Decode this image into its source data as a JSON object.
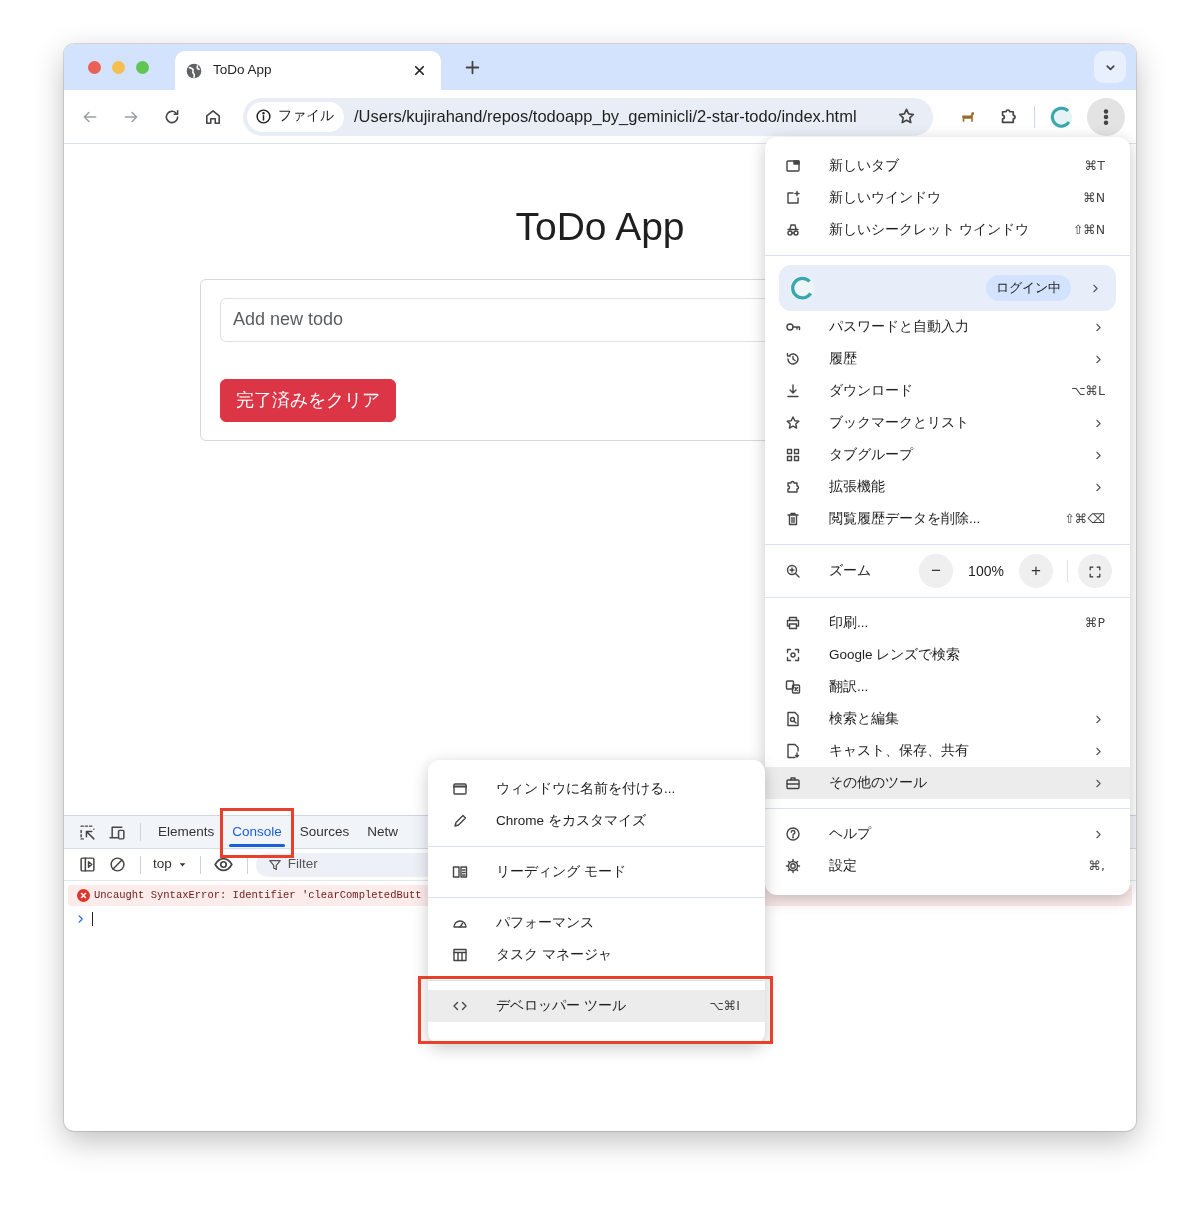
{
  "browser": {
    "tab": {
      "title": "ToDo App"
    },
    "address": {
      "chip": "ファイル",
      "url": "/Users/kujirahand/repos/todoapp_by_geminicli/2-star-todo/index.html"
    }
  },
  "page": {
    "title": "ToDo App",
    "input": {
      "placeholder": "Add new todo"
    },
    "clear_button": "完了済みをクリア"
  },
  "devtools": {
    "tabs": [
      {
        "label": "Elements",
        "selected": false,
        "annotated": false
      },
      {
        "label": "Console",
        "selected": true,
        "annotated": true
      },
      {
        "label": "Sources",
        "selected": false,
        "annotated": false
      },
      {
        "label": "Netw",
        "selected": false,
        "annotated": false
      }
    ],
    "context": "top",
    "filter": {
      "placeholder": "Filter"
    },
    "messages": [
      {
        "kind": "error",
        "text": "Uncaught SyntaxError: Identifier 'clearCompletedButt"
      }
    ]
  },
  "menu": {
    "sections": [
      {
        "items": [
          {
            "kind": "item",
            "label": "新しいタブ",
            "shortcut": "⌘T",
            "submenu": false,
            "selected": false
          },
          {
            "kind": "item",
            "label": "新しいウインドウ",
            "shortcut": "⌘N",
            "submenu": false,
            "selected": false
          },
          {
            "kind": "item",
            "label": "新しいシークレット ウインドウ",
            "shortcut": "⇧⌘N",
            "submenu": false,
            "selected": false
          }
        ]
      },
      {
        "items": [
          {
            "kind": "profile",
            "badge": "ログイン中",
            "submenu": true,
            "selected": false
          },
          {
            "kind": "item",
            "label": "パスワードと自動入力",
            "submenu": true,
            "selected": false
          },
          {
            "kind": "item",
            "label": "履歴",
            "submenu": true,
            "selected": false
          },
          {
            "kind": "item",
            "label": "ダウンロード",
            "shortcut": "⌥⌘L",
            "submenu": false,
            "selected": false
          },
          {
            "kind": "item",
            "label": "ブックマークとリスト",
            "submenu": true,
            "selected": false
          },
          {
            "kind": "item",
            "label": "タブグループ",
            "submenu": true,
            "selected": false
          },
          {
            "kind": "item",
            "label": "拡張機能",
            "submenu": true,
            "selected": false
          },
          {
            "kind": "item",
            "label": "閲覧履歴データを削除...",
            "shortcut": "⇧⌘⌫",
            "submenu": false,
            "selected": false
          }
        ]
      },
      {
        "items": [
          {
            "kind": "zoom",
            "label": "ズーム",
            "minus": "−",
            "value": "100%",
            "plus": "+"
          }
        ]
      },
      {
        "items": [
          {
            "kind": "item",
            "label": "印刷...",
            "shortcut": "⌘P",
            "submenu": false,
            "selected": false
          },
          {
            "kind": "item",
            "label": "Google レンズで検索",
            "submenu": false,
            "selected": false
          },
          {
            "kind": "item",
            "label": "翻訳...",
            "submenu": false,
            "selected": false
          },
          {
            "kind": "item",
            "label": "検索と編集",
            "submenu": true,
            "selected": false
          },
          {
            "kind": "item",
            "label": "キャスト、保存、共有",
            "submenu": true,
            "selected": false
          },
          {
            "kind": "item",
            "label": "その他のツール",
            "submenu": true,
            "selected": true
          }
        ]
      },
      {
        "items": [
          {
            "kind": "item",
            "label": "ヘルプ",
            "submenu": true,
            "selected": false
          },
          {
            "kind": "item",
            "label": "設定",
            "shortcut": "⌘,",
            "submenu": false,
            "selected": false
          }
        ]
      }
    ]
  },
  "submenu": {
    "sections": [
      {
        "items": [
          {
            "label": "ウィンドウに名前を付ける...",
            "selected": false,
            "annotated": false
          },
          {
            "label": "Chrome をカスタマイズ",
            "selected": false,
            "annotated": false
          }
        ]
      },
      {
        "items": [
          {
            "label": "リーディング モード",
            "selected": false,
            "annotated": false
          }
        ]
      },
      {
        "items": [
          {
            "label": "パフォーマンス",
            "selected": false,
            "annotated": false
          },
          {
            "label": "タスク マネージャ",
            "selected": false,
            "annotated": false
          }
        ]
      },
      {
        "items": [
          {
            "label": "デベロッパー ツール",
            "shortcut": "⌥⌘I",
            "selected": true,
            "annotated": true
          }
        ]
      }
    ]
  }
}
